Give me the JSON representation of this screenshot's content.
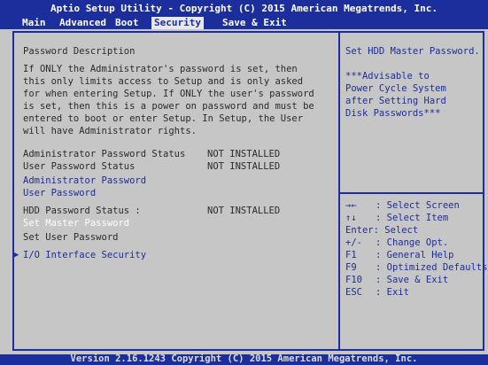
{
  "header": {
    "title": "Aptio Setup Utility - Copyright (C) 2015 American Megatrends, Inc.",
    "tabs": [
      "Main",
      "Advanced",
      "Boot",
      "Security",
      "Save & Exit"
    ]
  },
  "main": {
    "password_description_title": "Password Description",
    "description_lines": [
      "If ONLY the Administrator's password is set, then",
      "this only limits access to Setup and is only asked",
      "for when entering Setup. If ONLY the user's password",
      "is set, then this is a power on password and must be",
      "entered to boot or enter Setup. In Setup, the User",
      "will have Administrator rights."
    ],
    "admin_status_label": "Administrator Password Status",
    "admin_status_value": "NOT INSTALLED",
    "user_status_label": "User Password Status",
    "user_status_value": "NOT INSTALLED",
    "admin_password_link": "Administrator Password",
    "user_password_link": "User Password",
    "hdd_status_label": "HDD Password Status :",
    "hdd_status_value": "NOT INSTALLED",
    "set_master_password": "Set Master Password",
    "set_user_password": "Set User Password",
    "io_interface_security": "I/O Interface Security"
  },
  "help": {
    "lines": [
      "Set HDD Master Password.",
      "",
      "***Advisable to",
      "Power Cycle System",
      "after Setting Hard",
      "Disk Passwords***"
    ]
  },
  "keys": [
    {
      "key": "→←",
      "action": ": Select Screen"
    },
    {
      "key": "↑↓",
      "action": ": Select Item"
    },
    {
      "key": "Enter:",
      "action": "Select"
    },
    {
      "key": "+/-",
      "action": ": Change Opt."
    },
    {
      "key": "F1",
      "action": ": General Help"
    },
    {
      "key": "F9",
      "action": ": Optimized Defaults"
    },
    {
      "key": "F10",
      "action": ": Save & Exit"
    },
    {
      "key": "ESC",
      "action": ": Exit"
    }
  ],
  "footer": {
    "version": "Version 2.16.1243 Copyright (C) 2015 American Megatrends, Inc."
  },
  "colors": {
    "bar_blue": "#1c2d9c",
    "panel_gray": "#c6c6c6",
    "highlight_white": "#ffffff"
  }
}
